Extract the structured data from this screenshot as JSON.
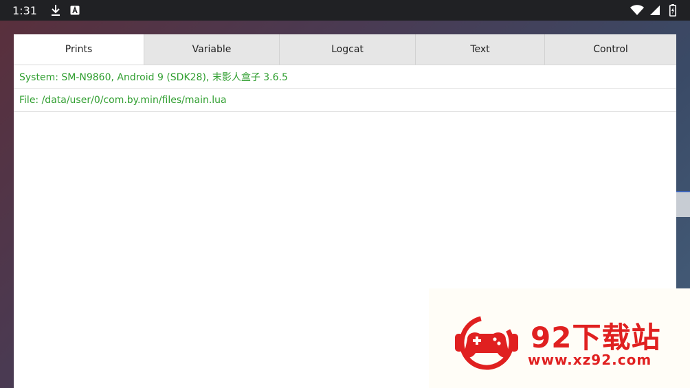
{
  "status_bar": {
    "time": "1:31",
    "left_icons": [
      "download-icon",
      "keyboard-a-icon"
    ],
    "right_icons": [
      "wifi-icon",
      "cellular-icon",
      "battery-charging-icon"
    ]
  },
  "tabs": [
    {
      "label": "Prints",
      "active": true
    },
    {
      "label": "Variable",
      "active": false
    },
    {
      "label": "Logcat",
      "active": false
    },
    {
      "label": "Text",
      "active": false
    },
    {
      "label": "Control",
      "active": false
    }
  ],
  "log_lines": [
    "System: SM-N9860, Android 9 (SDK28), 末影人盒子 3.6.5",
    "File: /data/user/0/com.by.min/files/main.lua"
  ],
  "watermark": {
    "title": "92下载站",
    "url": "www.xz92.com"
  },
  "colors": {
    "log_text": "#2f9e2f",
    "status_bar": "#202124",
    "tab_inactive": "#e6e6e6",
    "watermark_red": "#e02020"
  }
}
